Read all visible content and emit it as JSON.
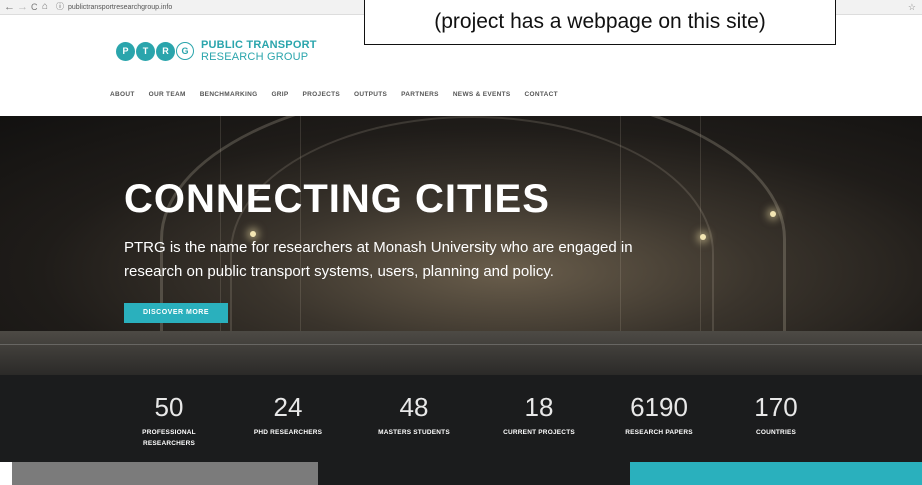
{
  "browser": {
    "back": "←",
    "forward": "→",
    "reload": "C",
    "home": "⌂",
    "info": "ⓘ",
    "url": "publictransportresearchgroup.info",
    "star": "☆"
  },
  "callout": {
    "text": "(project has a webpage on this site)"
  },
  "logo": {
    "letters": [
      "P",
      "T",
      "R",
      "G"
    ],
    "line1": "PUBLIC TRANSPORT",
    "line2": "RESEARCH GROUP"
  },
  "nav": [
    "ABOUT",
    "OUR TEAM",
    "BENCHMARKING",
    "GRIP",
    "PROJECTS",
    "OUTPUTS",
    "PARTNERS",
    "NEWS & EVENTS",
    "CONTACT"
  ],
  "hero": {
    "headline": "CONNECTING CITIES",
    "subline": "PTRG is the name for researchers at Monash University who are engaged in research on public transport systems, users, planning and policy.",
    "cta": "DISCOVER MORE"
  },
  "stats": [
    {
      "num": "50",
      "label": "PROFESSIONAL RESEARCHERS"
    },
    {
      "num": "24",
      "label": "PHD RESEARCHERS"
    },
    {
      "num": "48",
      "label": "MASTERS STUDENTS"
    },
    {
      "num": "18",
      "label": "CURRENT PROJECTS"
    },
    {
      "num": "6190",
      "label": "RESEARCH PAPERS"
    },
    {
      "num": "170",
      "label": "COUNTRIES"
    }
  ],
  "colors": {
    "accent": "#2ab0bd",
    "logo": "#2aa5ac",
    "stats_bg": "#1b1c1d"
  }
}
